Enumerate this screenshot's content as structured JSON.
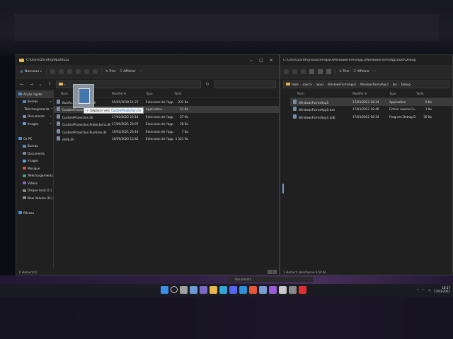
{
  "left_window": {
    "title": "C:\\Users\\Zentfrip\\Nudrtuaz",
    "toolbar": {
      "new_label": "Nouveau",
      "sort_label": "Trier",
      "view_label": "Afficher",
      "more_label": "···"
    },
    "address": {
      "path": "›"
    },
    "nav": [
      {
        "label": "Accès rapide",
        "level": 0,
        "color": "#4a90d9",
        "selected": true
      },
      {
        "label": "Bureau",
        "level": 1,
        "color": "#4a90d9",
        "pinned": true
      },
      {
        "label": "Téléchargements",
        "level": 1,
        "color": "#3ca370",
        "pinned": true
      },
      {
        "label": "Documents",
        "level": 1,
        "color": "#7a8ca8",
        "pinned": true
      },
      {
        "label": "Images",
        "level": 1,
        "color": "#5aa0d8",
        "pinned": true
      },
      {
        "label": "",
        "level": 1,
        "color": "",
        "pinned": false
      },
      {
        "label": "Ce PC",
        "level": 0,
        "color": "#4a90d9"
      },
      {
        "label": "Bureau",
        "level": 1,
        "color": "#4a90d9"
      },
      {
        "label": "Documents",
        "level": 1,
        "color": "#7a8ca8"
      },
      {
        "label": "Images",
        "level": 1,
        "color": "#5aa0d8"
      },
      {
        "label": "Musique",
        "level": 1,
        "color": "#d9534f"
      },
      {
        "label": "Téléchargements",
        "level": 1,
        "color": "#3ca370"
      },
      {
        "label": "Vidéos",
        "level": 1,
        "color": "#8e5bd1"
      },
      {
        "label": "Disque local (C:)",
        "level": 1,
        "color": "#888888"
      },
      {
        "label": "New Volume (D:)",
        "level": 1,
        "color": "#888888"
      },
      {
        "label": "",
        "level": 1,
        "color": "",
        "pinned": false
      },
      {
        "label": "Réseau",
        "level": 0,
        "color": "#4a90d9"
      }
    ],
    "columns": [
      "Nom",
      "Modifié le",
      "Type",
      "Taille"
    ],
    "files": [
      {
        "name": "Bunifu.UI.WinForms.dll",
        "modified": "05/05/2018 11:27",
        "type": "Extension de l'app...",
        "size": "231 Ko",
        "selected": false
      },
      {
        "name": "CustomProtection.exe",
        "modified": "17/02/2022 19:44",
        "type": "Application",
        "size": "51 Ko",
        "selected": true
      },
      {
        "name": "CustomProtection.dll",
        "modified": "17/02/2022 23:14",
        "type": "Extension de l'app...",
        "size": "27 Ko",
        "selected": false
      },
      {
        "name": "CustomProtection.Protections.dll",
        "modified": "17/06/2021 23:07",
        "type": "Extension de l'app...",
        "size": "28 Ko",
        "selected": false
      },
      {
        "name": "CustomProtection.Runtime.dll",
        "modified": "16/02/2021 23:14",
        "type": "Extension de l'app...",
        "size": "7 Ko",
        "selected": false
      },
      {
        "name": "dnlib.dll",
        "modified": "16/09/2020 13:42",
        "type": "Extension de l'app...",
        "size": "1 121 Ko",
        "selected": false
      }
    ],
    "status": "6 élément(s)",
    "drag_tooltip": {
      "prefix": "+",
      "text": "Déplacer vers",
      "destination": "CustomProtection.Ce"
    }
  },
  "right_window": {
    "title": "C:\\Users\\Zentfrip\\source\\repos\\WindowsFormsApp1\\WindowsFormsApp1\\bin\\Debug",
    "toolbar": {
      "sort_label": "Trier",
      "view_label": "Afficher",
      "more_label": "···"
    },
    "address": {
      "crumbs": [
        "lable",
        "source",
        "repos",
        "WindowsFormsApp1",
        "WindowsFormsApp1",
        "bin",
        "Debug"
      ]
    },
    "columns": [
      "Nom",
      "Modifié le",
      "Type",
      "Taille"
    ],
    "files": [
      {
        "name": "WindowsFormsApp1",
        "modified": "17/03/2022 18:34",
        "type": "Application",
        "size": "9 Ko",
        "selected": true
      },
      {
        "name": "WindowsFormsApp1.exe",
        "modified": "17/03/2022 18:46",
        "type": "Fichier source Co...",
        "size": "1 Ko",
        "selected": false
      },
      {
        "name": "WindowsFormsApp1.pdb",
        "modified": "17/03/2022 18:34",
        "type": "Program Debug D...",
        "size": "30 Ko",
        "selected": false
      }
    ],
    "status": "1 élément sélectionné  8,50 Ko"
  },
  "mini_window": {
    "label": "Documents"
  },
  "taskbar": {
    "icons": [
      {
        "name": "start-icon",
        "color": "#3b8ee6"
      },
      {
        "name": "search-icon",
        "color": "#d0d0d0"
      },
      {
        "name": "task-view-icon",
        "color": "#a0a0a0"
      },
      {
        "name": "widgets-icon",
        "color": "#6a9ad8"
      },
      {
        "name": "chat-icon",
        "color": "#7b68c8"
      },
      {
        "name": "file-explorer-icon",
        "color": "#e8b84a"
      },
      {
        "name": "edge-icon",
        "color": "#2fa8d8"
      },
      {
        "name": "discord-icon",
        "color": "#5865f2"
      },
      {
        "name": "vscode-icon",
        "color": "#2f8fd8"
      },
      {
        "name": "brave-icon",
        "color": "#e8553b"
      },
      {
        "name": "files-icon",
        "color": "#7a9ad8"
      },
      {
        "name": "visual-studio-icon",
        "color": "#9a5ad8"
      },
      {
        "name": "gallery-icon",
        "color": "#c8c8c8"
      },
      {
        "name": "terminal-icon",
        "color": "#888888"
      },
      {
        "name": "opera-icon",
        "color": "#e03030"
      }
    ],
    "time": "18:57",
    "date": "17/03/2022"
  }
}
